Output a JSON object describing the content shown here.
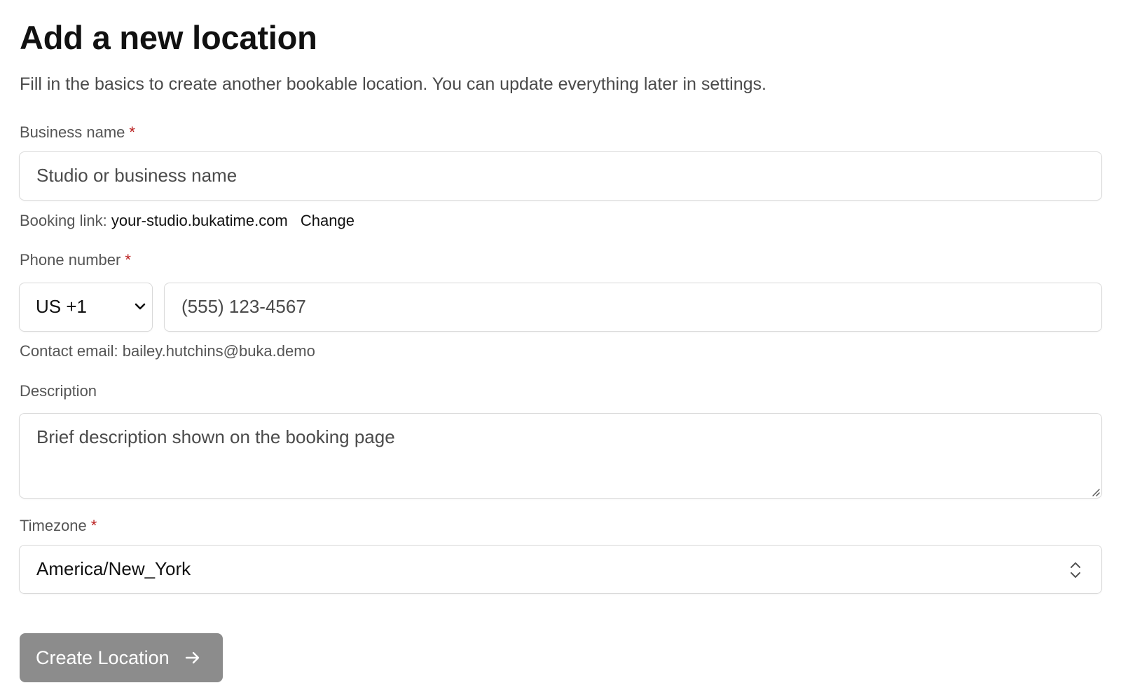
{
  "header": {
    "title": "Add a new location",
    "subtitle": "Fill in the basics to create another bookable location. You can update everything later in settings."
  },
  "business_name": {
    "label": "Business name",
    "required_mark": "*",
    "placeholder": "Studio or business name"
  },
  "booking_link": {
    "prefix": "Booking link:",
    "url": "your-studio.bukatime.com",
    "change_label": "Change"
  },
  "phone": {
    "label": "Phone number",
    "required_mark": "*",
    "country_code": "US +1",
    "placeholder": "(555) 123-4567"
  },
  "contact_email": {
    "text": "Contact email: bailey.hutchins@buka.demo"
  },
  "description": {
    "label": "Description",
    "placeholder": "Brief description shown on the booking page"
  },
  "timezone": {
    "label": "Timezone",
    "required_mark": "*",
    "value": "America/New_York"
  },
  "submit": {
    "label": "Create Location"
  },
  "icons": {
    "country_select": "chevron-down-icon",
    "timezone_select": "chevron-up-down-icon",
    "textarea_resize": "resize-grip-icon",
    "submit_arrow": "arrow-right-icon"
  },
  "colors": {
    "required": "#b91c1c",
    "button_bg": "#8c8c8c",
    "button_text": "#ffffff",
    "border": "#d9d9d9"
  }
}
